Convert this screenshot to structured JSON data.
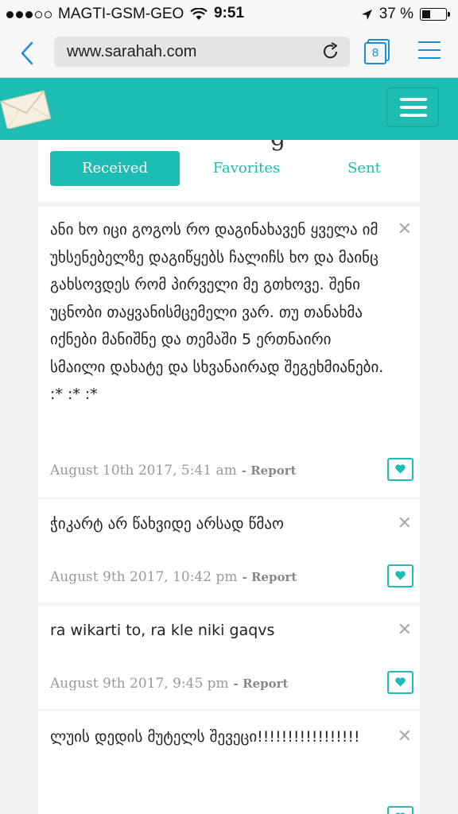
{
  "status_bar": {
    "carrier": "MAGTI-GSM-GEO",
    "time": "9:51",
    "battery": "37 %",
    "battery_level": 0.37
  },
  "browser": {
    "url": "www.sarahah.com",
    "tabs_count": "8"
  },
  "tabs": [
    {
      "label": "Received",
      "active": true
    },
    {
      "label": "Favorites",
      "active": false
    },
    {
      "label": "Sent",
      "active": false
    }
  ],
  "messages": [
    {
      "text": "ანი ხო იცი გოგოს რო დაგინახავენ ყველა იმ უხსენებელზე დაგიწყებს ჩალიჩს ხო და მაინც გახსოვდეს რომ პირველი მე გთხოვე. შენი უცნობი თაყვანისმცემელი ვარ. თუ თანახმა იქნები მანიშნე და თემაში 5 ერთნაირი სმაილი დახატე და სხვანაირად შეგეხმიანები. :* :* :*",
      "date": "August 10th 2017, 5:41 am",
      "report": "- Report"
    },
    {
      "text": "ჭიკარტ არ წახვიდე არსად წმაო",
      "date": "August 9th 2017, 10:42 pm",
      "report": "- Report"
    },
    {
      "text": "ra wikarti to, ra kle niki gaqvs",
      "date": "August 9th 2017, 9:45 pm",
      "report": "- Report"
    },
    {
      "text": "ლუის დედის მუტელს შევეცი!!!!!!!!!!!!!!!!!",
      "date": "",
      "report": ""
    }
  ],
  "colors": {
    "accent": "#1dbdb4",
    "ios_blue": "#1a8fd6"
  }
}
